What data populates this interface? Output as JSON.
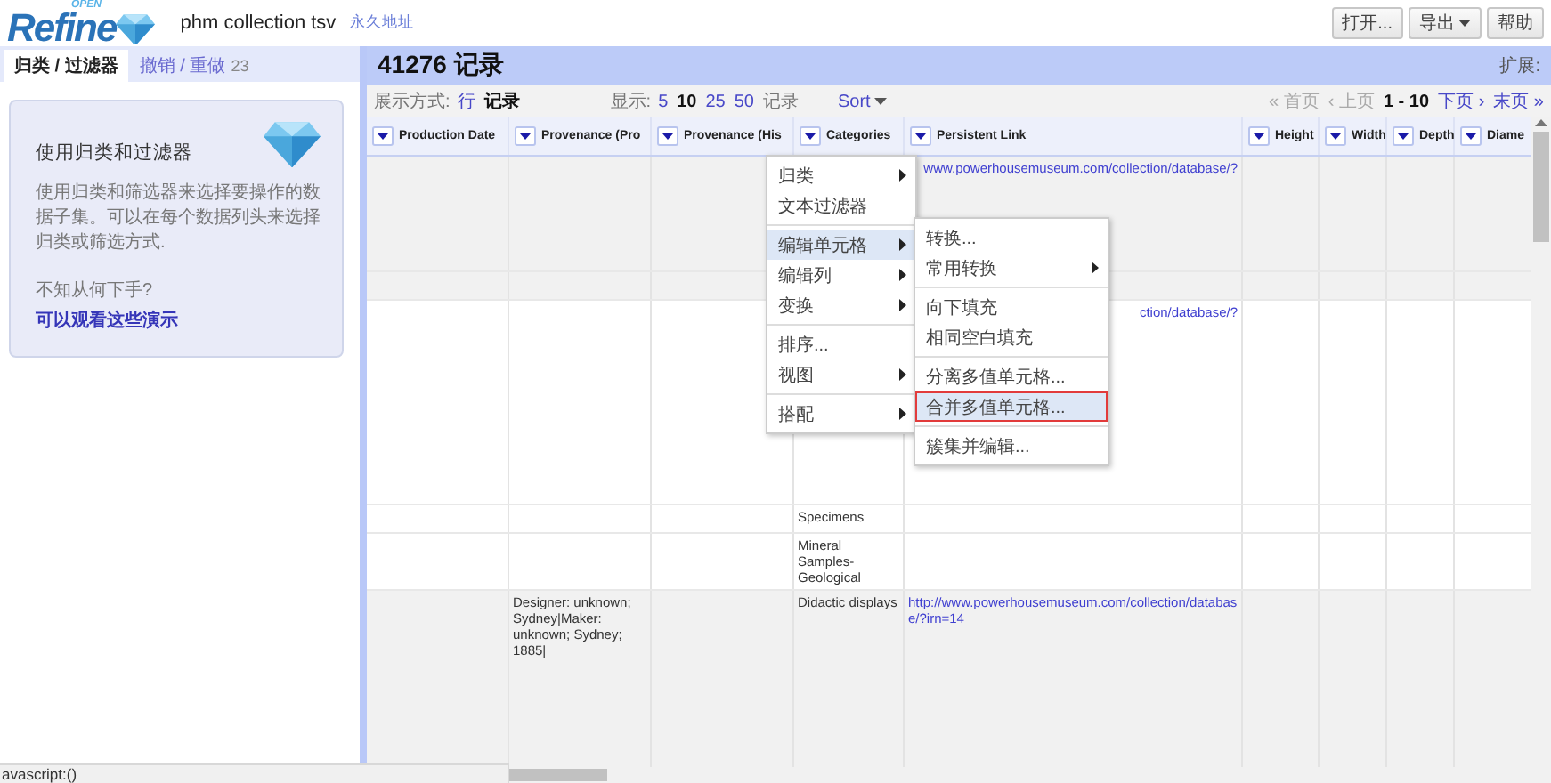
{
  "header": {
    "logo": {
      "word": "Refine",
      "tag": "OPEN"
    },
    "project_name": "phm collection tsv",
    "permalink": "永久地址",
    "buttons": [
      {
        "label": "打开...",
        "caret": false
      },
      {
        "label": "导出",
        "caret": true
      },
      {
        "label": "帮助",
        "caret": false
      }
    ]
  },
  "left_panel": {
    "tabs": [
      {
        "label": "归类 / 过滤器",
        "selected": true
      },
      {
        "label": "撤销 / 重做",
        "count": "23",
        "selected": false
      }
    ],
    "help_card": {
      "title": "使用归类和过滤器",
      "body": "使用归类和筛选器来选择要操作的数据子集。可以在每个数据列头来选择归类或筛选方式.",
      "question": "不知从何下手?",
      "link": "可以观看这些演示"
    }
  },
  "summary": {
    "count": "41276 记录",
    "extensions_label": "扩展:"
  },
  "toolbar": {
    "view_label": "展示方式:",
    "view_modes": [
      {
        "label": "行",
        "selected": false
      },
      {
        "label": "记录",
        "selected": true
      }
    ],
    "show_label": "显示:",
    "page_sizes": [
      {
        "label": "5",
        "selected": false
      },
      {
        "label": "10",
        "selected": true
      },
      {
        "label": "25",
        "selected": false
      },
      {
        "label": "50",
        "selected": false
      }
    ],
    "show_unit": "记录",
    "sort": "Sort",
    "pager": [
      {
        "kind": "link",
        "label": "« 首页",
        "disabled": true
      },
      {
        "kind": "link",
        "label": "‹ 上页",
        "disabled": true
      },
      {
        "kind": "range",
        "label": "1 - 10"
      },
      {
        "kind": "link",
        "label": "下页 ›",
        "disabled": false
      },
      {
        "kind": "link",
        "label": "末页 »",
        "disabled": false
      }
    ]
  },
  "table": {
    "columns": [
      {
        "label": "Production Date",
        "kind": "text"
      },
      {
        "label": "Provenance (Pro",
        "kind": "text"
      },
      {
        "label": "Provenance (His",
        "kind": "text"
      },
      {
        "label": "Categories",
        "kind": "text"
      },
      {
        "label": "Persistent Link",
        "kind": "link"
      },
      {
        "label": "Height",
        "kind": "text"
      },
      {
        "label": "Width",
        "kind": "text"
      },
      {
        "label": "Depth",
        "kind": "text"
      },
      {
        "label": "Diame",
        "kind": "text"
      }
    ],
    "records": [
      {
        "rows": [
          {
            "cells": [
              null,
              null,
              null,
              null,
              "www.powerhousemuseum.com/collection/database/?",
              null,
              null,
              null,
              null
            ]
          },
          {
            "cells": [
              null,
              null,
              null,
              null,
              null,
              null,
              null,
              null,
              null
            ]
          }
        ]
      },
      {
        "rows": [
          {
            "cells": [
              null,
              null,
              null,
              null,
              "ction/database/?",
              null,
              null,
              null,
              null
            ]
          },
          {
            "cells": [
              null,
              null,
              null,
              "Specimens",
              null,
              null,
              null,
              null,
              null
            ]
          },
          {
            "cells": [
              null,
              null,
              null,
              "Mineral Samples-Geological",
              null,
              null,
              null,
              null,
              null
            ]
          }
        ]
      },
      {
        "rows": [
          {
            "cells": [
              null,
              "Designer: unknown; Sydney|Maker: unknown; Sydney; 1885|",
              null,
              "Didactic displays",
              "http://www.powerhousemuseum.com/collection/database/?irn=14",
              null,
              null,
              null,
              null
            ]
          }
        ]
      }
    ]
  },
  "column_menu": {
    "items": [
      {
        "kind": "item",
        "label": "归类",
        "submenu": true,
        "selected": false
      },
      {
        "kind": "item",
        "label": "文本过滤器",
        "submenu": false,
        "selected": false
      },
      {
        "kind": "separator"
      },
      {
        "kind": "item",
        "label": "编辑单元格",
        "submenu": true,
        "selected": true
      },
      {
        "kind": "item",
        "label": "编辑列",
        "submenu": true,
        "selected": false
      },
      {
        "kind": "item",
        "label": "变换",
        "submenu": true,
        "selected": false
      },
      {
        "kind": "separator"
      },
      {
        "kind": "item",
        "label": "排序...",
        "submenu": false,
        "selected": false
      },
      {
        "kind": "item",
        "label": "视图",
        "submenu": true,
        "selected": false
      },
      {
        "kind": "separator"
      },
      {
        "kind": "item",
        "label": "搭配",
        "submenu": true,
        "selected": false
      }
    ]
  },
  "submenu": {
    "items": [
      {
        "kind": "item",
        "label": "转换...",
        "submenu": false,
        "selected": false,
        "annotated": false
      },
      {
        "kind": "item",
        "label": "常用转换",
        "submenu": true,
        "selected": false,
        "annotated": false
      },
      {
        "kind": "separator"
      },
      {
        "kind": "item",
        "label": "向下填充",
        "submenu": false,
        "selected": false,
        "annotated": false
      },
      {
        "kind": "item",
        "label": "相同空白填充",
        "submenu": false,
        "selected": false,
        "annotated": false
      },
      {
        "kind": "separator"
      },
      {
        "kind": "item",
        "label": "分离多值单元格...",
        "submenu": false,
        "selected": false,
        "annotated": false
      },
      {
        "kind": "item",
        "label": "合并多值单元格...",
        "submenu": false,
        "selected": true,
        "annotated": true
      },
      {
        "kind": "separator"
      },
      {
        "kind": "item",
        "label": "簇集并编辑...",
        "submenu": false,
        "selected": false,
        "annotated": false
      }
    ]
  },
  "status_bar": {
    "url": "avascript:()"
  }
}
